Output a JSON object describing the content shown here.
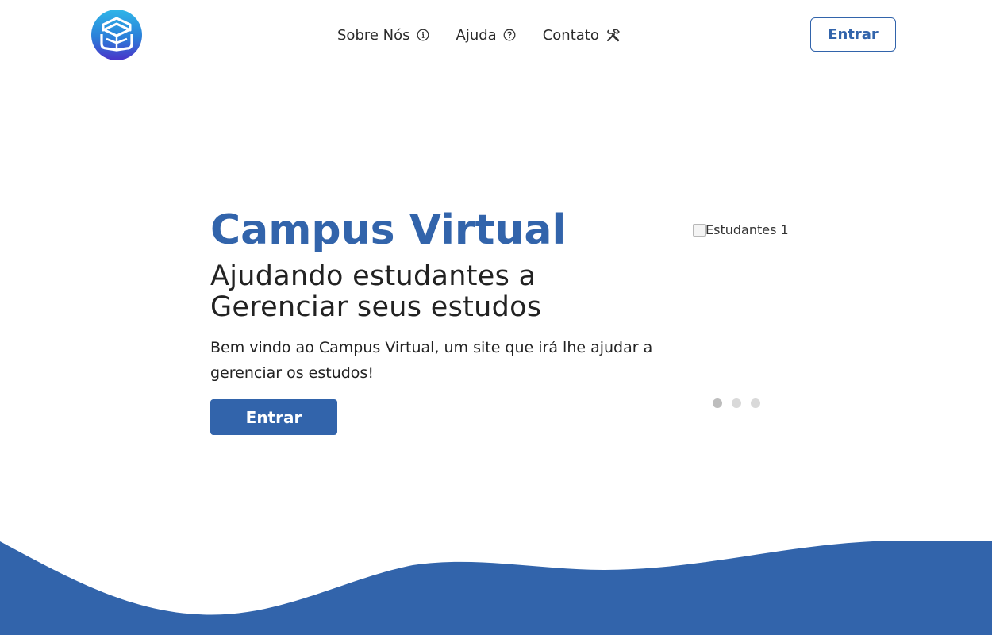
{
  "header": {
    "logo_icon": "book-shield-logo",
    "nav": [
      {
        "label": "Sobre Nós",
        "icon": "info-circle-icon"
      },
      {
        "label": "Ajuda",
        "icon": "question-circle-icon"
      },
      {
        "label": "Contato",
        "icon": "tools-icon"
      }
    ],
    "login_label": "Entrar"
  },
  "hero": {
    "title": "Campus Virtual",
    "subtitle_line1": "Ajudando estudantes a",
    "subtitle_line2": "Gerenciar seus estudos",
    "description": "Bem vindo ao Campus Virtual, um site que irá lhe ajudar a gerenciar os estudos!",
    "cta_label": "Entrar"
  },
  "carousel": {
    "image_alt": "Estudantes 1",
    "slide_count": 3,
    "active_index": 0
  },
  "colors": {
    "brand": "#3264ab",
    "text": "#222222",
    "wave": "#3264ab"
  }
}
